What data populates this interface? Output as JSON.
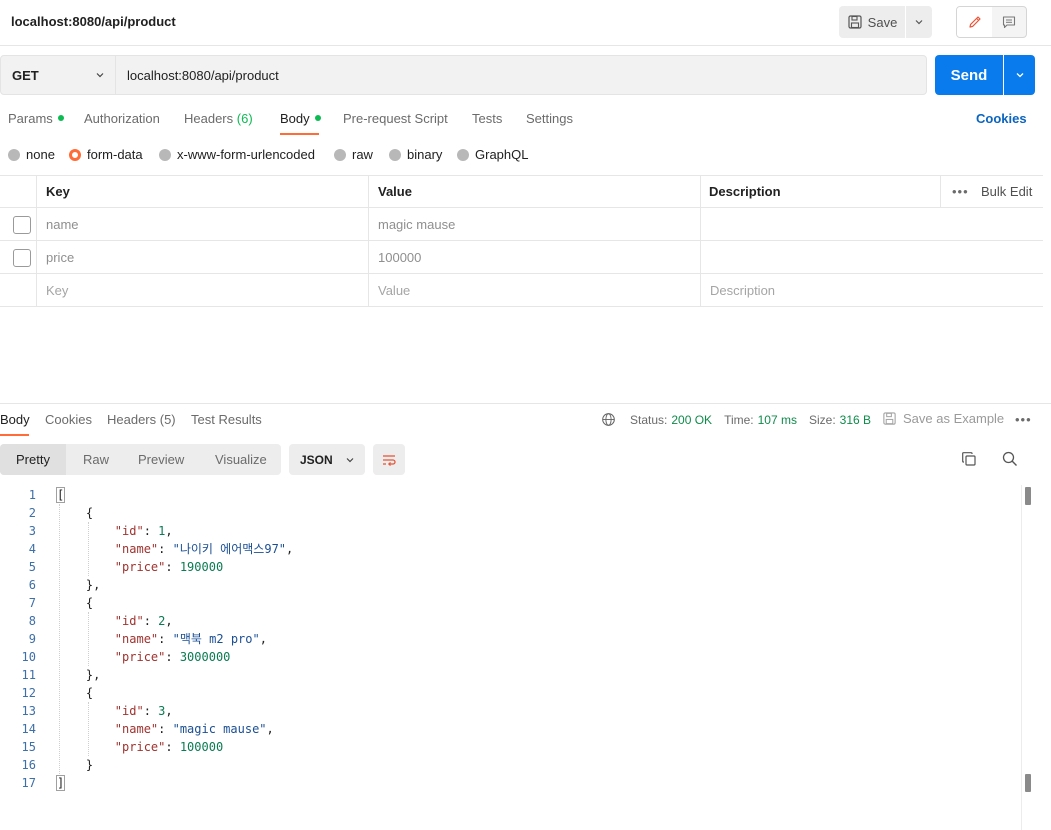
{
  "header": {
    "request_title": "localhost:8080/api/product",
    "save_label": "Save"
  },
  "request": {
    "method": "GET",
    "url": "localhost:8080/api/product",
    "send_label": "Send"
  },
  "request_tabs": {
    "params": "Params",
    "authorization": "Authorization",
    "headers": "Headers",
    "headers_count": "(6)",
    "body": "Body",
    "pre_request": "Pre-request Script",
    "tests": "Tests",
    "settings": "Settings",
    "cookies": "Cookies"
  },
  "body_types": {
    "none": "none",
    "form_data": "form-data",
    "urlencoded": "x-www-form-urlencoded",
    "raw": "raw",
    "binary": "binary",
    "graphql": "GraphQL",
    "selected": "form-data"
  },
  "params_table": {
    "headers": {
      "key": "Key",
      "value": "Value",
      "description": "Description",
      "bulk_edit": "Bulk Edit"
    },
    "rows": [
      {
        "key": "name",
        "value": "magic mause"
      },
      {
        "key": "price",
        "value": "100000"
      }
    ],
    "placeholders": {
      "key": "Key",
      "value": "Value",
      "description": "Description"
    }
  },
  "response_tabs": {
    "body": "Body",
    "cookies": "Cookies",
    "headers": "Headers (5)",
    "test_results": "Test Results"
  },
  "response_status": {
    "status_label": "Status:",
    "status_value": "200 OK",
    "time_label": "Time:",
    "time_value": "107 ms",
    "size_label": "Size:",
    "size_value": "316 B",
    "save_example": "Save as Example"
  },
  "view_modes": {
    "pretty": "Pretty",
    "raw": "Raw",
    "preview": "Preview",
    "visualize": "Visualize",
    "format": "JSON"
  },
  "code_lines": [
    {
      "no": "1",
      "p": [
        {
          "c": "b",
          "t": "["
        }
      ]
    },
    {
      "no": "2",
      "p": [
        {
          "c": "p",
          "t": "    {"
        }
      ]
    },
    {
      "no": "3",
      "p": [
        {
          "c": "p",
          "t": "        "
        },
        {
          "c": "k",
          "t": "\"id\""
        },
        {
          "c": "p",
          "t": ": "
        },
        {
          "c": "n",
          "t": "1"
        },
        {
          "c": "p",
          "t": ","
        }
      ]
    },
    {
      "no": "4",
      "p": [
        {
          "c": "p",
          "t": "        "
        },
        {
          "c": "k",
          "t": "\"name\""
        },
        {
          "c": "p",
          "t": ": "
        },
        {
          "c": "s",
          "t": "\"나이키 에어맥스97\""
        },
        {
          "c": "p",
          "t": ","
        }
      ]
    },
    {
      "no": "5",
      "p": [
        {
          "c": "p",
          "t": "        "
        },
        {
          "c": "k",
          "t": "\"price\""
        },
        {
          "c": "p",
          "t": ": "
        },
        {
          "c": "n",
          "t": "190000"
        }
      ]
    },
    {
      "no": "6",
      "p": [
        {
          "c": "p",
          "t": "    },"
        }
      ]
    },
    {
      "no": "7",
      "p": [
        {
          "c": "p",
          "t": "    {"
        }
      ]
    },
    {
      "no": "8",
      "p": [
        {
          "c": "p",
          "t": "        "
        },
        {
          "c": "k",
          "t": "\"id\""
        },
        {
          "c": "p",
          "t": ": "
        },
        {
          "c": "n",
          "t": "2"
        },
        {
          "c": "p",
          "t": ","
        }
      ]
    },
    {
      "no": "9",
      "p": [
        {
          "c": "p",
          "t": "        "
        },
        {
          "c": "k",
          "t": "\"name\""
        },
        {
          "c": "p",
          "t": ": "
        },
        {
          "c": "s",
          "t": "\"맥북 m2 pro\""
        },
        {
          "c": "p",
          "t": ","
        }
      ]
    },
    {
      "no": "10",
      "p": [
        {
          "c": "p",
          "t": "        "
        },
        {
          "c": "k",
          "t": "\"price\""
        },
        {
          "c": "p",
          "t": ": "
        },
        {
          "c": "n",
          "t": "3000000"
        }
      ]
    },
    {
      "no": "11",
      "p": [
        {
          "c": "p",
          "t": "    },"
        }
      ]
    },
    {
      "no": "12",
      "p": [
        {
          "c": "p",
          "t": "    {"
        }
      ]
    },
    {
      "no": "13",
      "p": [
        {
          "c": "p",
          "t": "        "
        },
        {
          "c": "k",
          "t": "\"id\""
        },
        {
          "c": "p",
          "t": ": "
        },
        {
          "c": "n",
          "t": "3"
        },
        {
          "c": "p",
          "t": ","
        }
      ]
    },
    {
      "no": "14",
      "p": [
        {
          "c": "p",
          "t": "        "
        },
        {
          "c": "k",
          "t": "\"name\""
        },
        {
          "c": "p",
          "t": ": "
        },
        {
          "c": "s",
          "t": "\"magic mause\""
        },
        {
          "c": "p",
          "t": ","
        }
      ]
    },
    {
      "no": "15",
      "p": [
        {
          "c": "p",
          "t": "        "
        },
        {
          "c": "k",
          "t": "\"price\""
        },
        {
          "c": "p",
          "t": ": "
        },
        {
          "c": "n",
          "t": "100000"
        }
      ]
    },
    {
      "no": "16",
      "p": [
        {
          "c": "p",
          "t": "    }"
        }
      ]
    },
    {
      "no": "17",
      "p": [
        {
          "c": "b",
          "t": "]"
        }
      ]
    }
  ],
  "colors": {
    "accent_orange": "#ff6c37",
    "send_blue": "#097bed",
    "status_green": "#0f8b4a",
    "link_blue": "#0b64c0"
  },
  "icons": {
    "save": "floppy-disk-icon",
    "edit": "pencil-icon",
    "docs": "comment-icon",
    "globe": "globe-icon",
    "copy": "copy-icon",
    "search": "search-icon",
    "wrap": "wrap-lines-icon"
  }
}
